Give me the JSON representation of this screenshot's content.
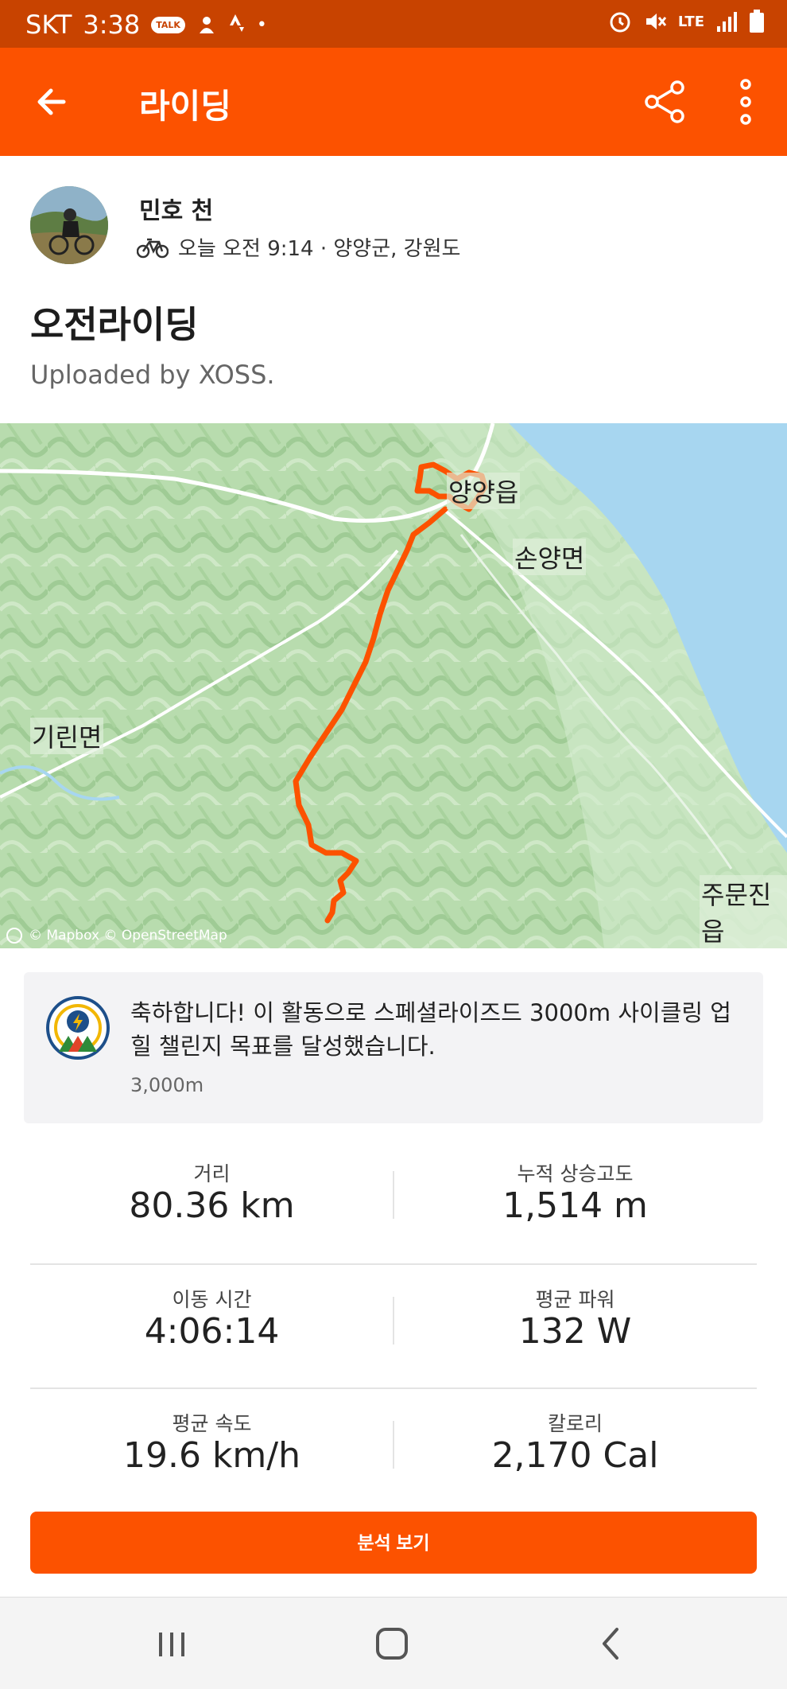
{
  "status_bar": {
    "carrier": "SKT",
    "time": "3:38",
    "talk_badge": "TALK",
    "lte": "LTE"
  },
  "app_bar": {
    "title": "라이딩",
    "icons": [
      "back-arrow-icon",
      "share-icon",
      "more-vertical-icon"
    ]
  },
  "athlete": {
    "name": "민호 천",
    "meta": "오늘 오전 9:14 · 양양군, 강원도",
    "sport_icon": "bicycle-icon"
  },
  "activity": {
    "title": "오전라이딩",
    "description": "Uploaded by XOSS."
  },
  "map": {
    "labels": {
      "town": "양양읍",
      "sonyang": "손양면",
      "girin": "기린면",
      "jumunjin": "주문진읍"
    },
    "attribution": "© Mapbox © OpenStreetMap",
    "route_color": "#fc5200",
    "water_color": "#a7d6f0"
  },
  "achievement": {
    "text": "축하합니다! 이 활동으로 스페셜라이즈드 3000m 사이클링 업힐 챌린지 목표를 달성했습니다.",
    "subtext": "3,000m",
    "badge_icon": "challenge-badge-icon"
  },
  "stats": [
    {
      "label": "거리",
      "value": "80.36 km"
    },
    {
      "label": "누적 상승고도",
      "value": "1,514 m"
    },
    {
      "label": "이동 시간",
      "value": "4:06:14"
    },
    {
      "label": "평균 파워",
      "value": "132 W"
    },
    {
      "label": "평균 속도",
      "value": "19.6 km/h"
    },
    {
      "label": "칼로리",
      "value": "2,170 Cal"
    }
  ],
  "analysis_button": {
    "label": "분석 보기"
  },
  "nav_bar": {
    "icons": [
      "recent-apps-icon",
      "home-icon",
      "back-icon"
    ]
  },
  "colors": {
    "brand": "#fc5200",
    "status_bar": "#c84300"
  }
}
